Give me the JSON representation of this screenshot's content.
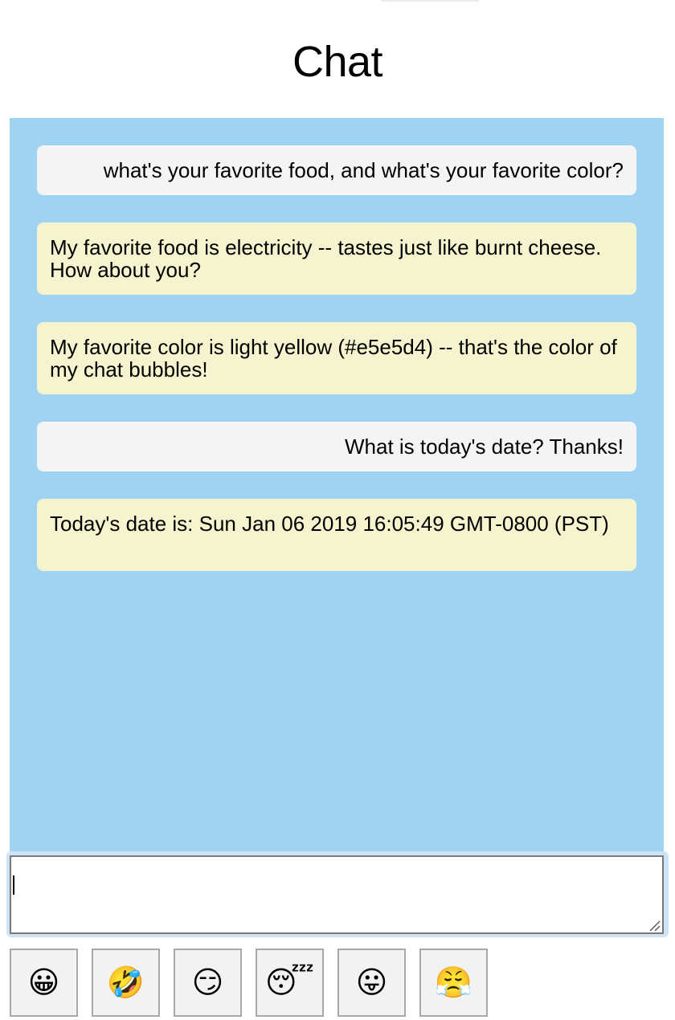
{
  "page": {
    "title": "Chat"
  },
  "colors": {
    "panel_background": "#9fd3f1",
    "user_bubble": "#f4f4f4",
    "bot_bubble": "#f6f4cf"
  },
  "messages": [
    {
      "sender": "user",
      "text": "what's your favorite food, and what's your favorite color?"
    },
    {
      "sender": "bot",
      "text": "My favorite food is electricity -- tastes just like burnt cheese. How about you?"
    },
    {
      "sender": "bot",
      "text": "My favorite color is light yellow (#e5e5d4) -- that's the color of my chat bubbles!"
    },
    {
      "sender": "user",
      "text": "What is today's date? Thanks!"
    },
    {
      "sender": "bot",
      "text": "Today's date is: Sun Jan 06 2019 16:05:49 GMT-0800 (PST)"
    }
  ],
  "composer": {
    "value": ""
  },
  "emoji_buttons": [
    {
      "icon": "grinning-face-icon",
      "glyph": "😀"
    },
    {
      "icon": "rolling-on-floor-laughing-icon",
      "glyph": "🤣"
    },
    {
      "icon": "smirking-face-icon",
      "glyph": "😏"
    },
    {
      "icon": "sleeping-face-icon",
      "glyph": "😴"
    },
    {
      "icon": "face-with-tongue-icon",
      "glyph": "😛"
    },
    {
      "icon": "face-with-steam-from-nose-icon",
      "glyph": "😤"
    }
  ]
}
